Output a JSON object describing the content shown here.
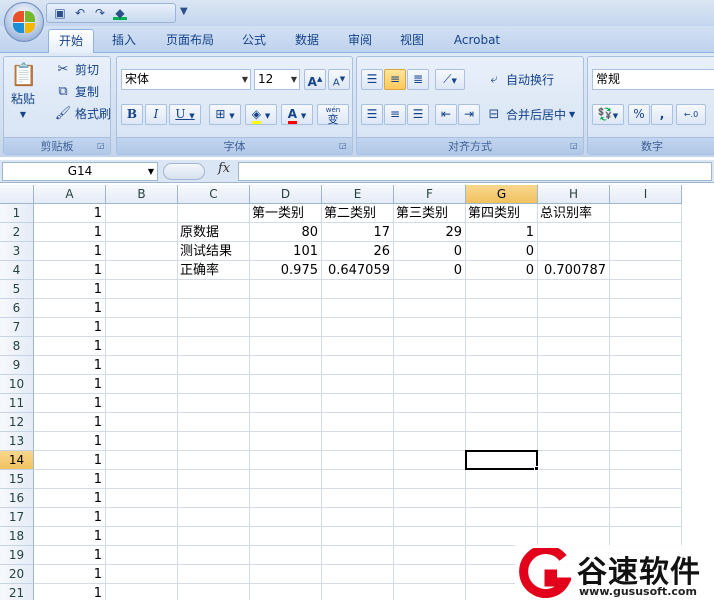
{
  "quick_access": {
    "icons": [
      "save-icon",
      "undo-icon",
      "redo-icon",
      "fill-color-icon"
    ]
  },
  "tabs": [
    {
      "label": "开始",
      "active": true
    },
    {
      "label": "插入"
    },
    {
      "label": "页面布局"
    },
    {
      "label": "公式"
    },
    {
      "label": "数据"
    },
    {
      "label": "审阅"
    },
    {
      "label": "视图"
    },
    {
      "label": "Acrobat"
    }
  ],
  "ribbon": {
    "clipboard": {
      "paste_label": "粘贴",
      "cut_label": "剪切",
      "copy_label": "复制",
      "format_painter_label": "格式刷",
      "group_label": "剪贴板"
    },
    "font": {
      "font_name": "宋体",
      "font_size": "12",
      "grow_label": "A",
      "shrink_label": "A",
      "bold_label": "B",
      "italic_label": "I",
      "underline_label": "U",
      "font_color_label": "A",
      "phonetic_label": "变",
      "phonetic_top": "wén",
      "group_label": "字体"
    },
    "alignment": {
      "wrap_text_label": "自动换行",
      "merge_center_label": "合并后居中",
      "group_label": "对齐方式"
    },
    "number": {
      "format": "常规",
      "percent_label": "%",
      "comma_label": ",",
      "group_label": "数字"
    }
  },
  "colors": {
    "highlight_yellow": "#ffff00",
    "font_red": "#ff0000",
    "selection_header": "#f1c15f"
  },
  "formula_bar": {
    "name_box": "G14",
    "fx_label": "fx",
    "value": ""
  },
  "sheet": {
    "columns": [
      "A",
      "B",
      "C",
      "D",
      "E",
      "F",
      "G",
      "H",
      "I"
    ],
    "selected_column": "G",
    "selected_row": 14,
    "row_count": 21,
    "column_a_values": [
      "1",
      "1",
      "1",
      "1",
      "1",
      "1",
      "1",
      "1",
      "1",
      "1",
      "1",
      "1",
      "1",
      "1",
      "1",
      "1",
      "1",
      "1",
      "1",
      "1",
      "1"
    ],
    "header_row": [
      "第一类别",
      "第二类别",
      "第三类别",
      "第四类别",
      "总识别率"
    ],
    "rows": [
      {
        "label": "原数据",
        "values": [
          "80",
          "17",
          "29",
          "1",
          ""
        ]
      },
      {
        "label": "测试结果",
        "values": [
          "101",
          "26",
          "0",
          "0",
          ""
        ]
      },
      {
        "label": "正确率",
        "values": [
          "0.975",
          "0.647059",
          "0",
          "0",
          "0.700787"
        ]
      }
    ]
  },
  "watermark": {
    "title": "谷速软件",
    "url": "www.gususoft.com"
  }
}
